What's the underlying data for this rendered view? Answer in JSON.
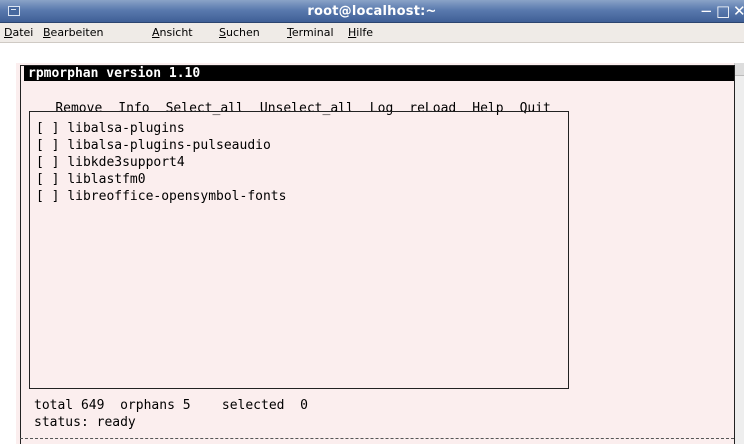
{
  "window": {
    "title": "root@localhost:~",
    "buttons": {
      "minimize": "−",
      "maximize": "□",
      "close": "✕"
    }
  },
  "menubar": [
    {
      "accel": "D",
      "rest": "atei"
    },
    {
      "accel": "B",
      "rest": "earbeiten"
    },
    {
      "accel": "A",
      "rest": "nsicht"
    },
    {
      "accel": "S",
      "rest": "uchen"
    },
    {
      "accel": "T",
      "rest": "erminal"
    },
    {
      "accel": "H",
      "rest": "ilfe"
    }
  ],
  "app": {
    "header": "rpmorphan version 1.10",
    "menu": [
      "Remove",
      "Info",
      "Select_all",
      "Unselect_all",
      "Log",
      "reLoad",
      "Help",
      "Quit"
    ],
    "checkbox": "[ ]",
    "packages": [
      "libalsa-plugins",
      "libalsa-plugins-pulseaudio",
      "libkde3support4",
      "liblastfm0",
      "libreoffice-opensymbol-fonts"
    ],
    "footer": {
      "total_label": "total",
      "total": "649",
      "orphans_label": "orphans",
      "orphans": "5",
      "selected_label": "selected",
      "selected": "0",
      "status_label": "status:",
      "status": "ready"
    }
  },
  "colors": {
    "titlebar": "#4f6fa3",
    "menubar": "#efebe7",
    "terminal_bg": "#fbeeee",
    "header_bg": "#000000"
  }
}
